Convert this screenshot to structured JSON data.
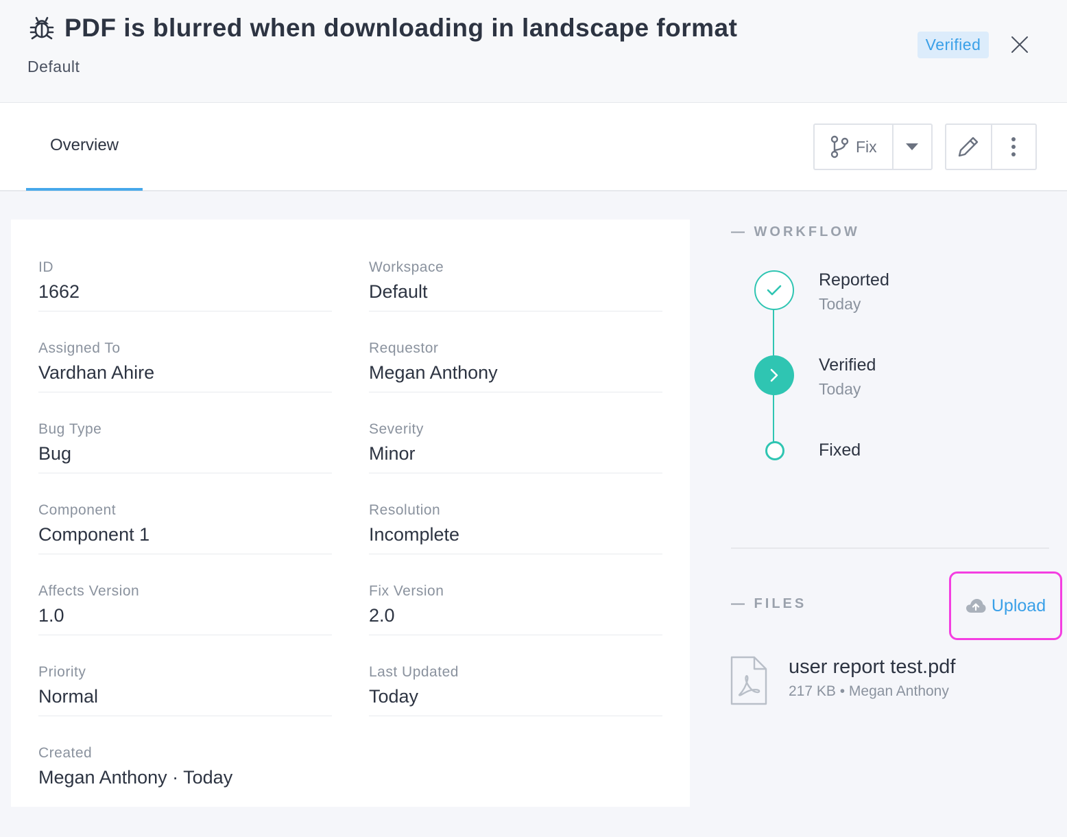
{
  "header": {
    "title": "PDF is blurred when downloading in landscape format",
    "subtitle": "Default",
    "status": "Verified",
    "icon": "bug-icon"
  },
  "tabs": [
    {
      "label": "Overview",
      "active": true
    }
  ],
  "toolbar": {
    "fix_label": "Fix",
    "fix_icon": "branch-icon",
    "caret_icon": "caret-down-icon",
    "edit_icon": "pencil-icon",
    "more_icon": "more-vertical-icon"
  },
  "details": {
    "id": {
      "label": "ID",
      "value": "1662"
    },
    "workspace": {
      "label": "Workspace",
      "value": "Default"
    },
    "assigned_to": {
      "label": "Assigned To",
      "value": "Vardhan Ahire"
    },
    "requestor": {
      "label": "Requestor",
      "value": "Megan Anthony"
    },
    "bug_type": {
      "label": "Bug Type",
      "value": "Bug"
    },
    "severity": {
      "label": "Severity",
      "value": "Minor"
    },
    "component": {
      "label": "Component",
      "value": "Component 1"
    },
    "resolution": {
      "label": "Resolution",
      "value": "Incomplete"
    },
    "affects_version": {
      "label": "Affects Version",
      "value": "1.0"
    },
    "fix_version": {
      "label": "Fix Version",
      "value": "2.0"
    },
    "priority": {
      "label": "Priority",
      "value": "Normal"
    },
    "last_updated": {
      "label": "Last Updated",
      "value": "Today"
    },
    "created": {
      "label": "Created",
      "value": "Megan Anthony · Today"
    }
  },
  "workflow": {
    "heading": "— WORKFLOW",
    "steps": [
      {
        "label": "Reported",
        "date": "Today",
        "state": "done"
      },
      {
        "label": "Verified",
        "date": "Today",
        "state": "current"
      },
      {
        "label": "Fixed",
        "date": "",
        "state": "todo"
      }
    ]
  },
  "files": {
    "heading": "— FILES",
    "upload_label": "Upload",
    "upload_icon": "cloud-upload-icon",
    "items": [
      {
        "name": "user report test.pdf",
        "meta": "217 KB • Megan Anthony",
        "icon": "pdf-file-icon"
      }
    ]
  },
  "colors": {
    "accent": "#3aa0e8",
    "workflow": "#2fc5b2",
    "badge_bg": "#dcecfb",
    "highlight": "#f43ee1"
  }
}
